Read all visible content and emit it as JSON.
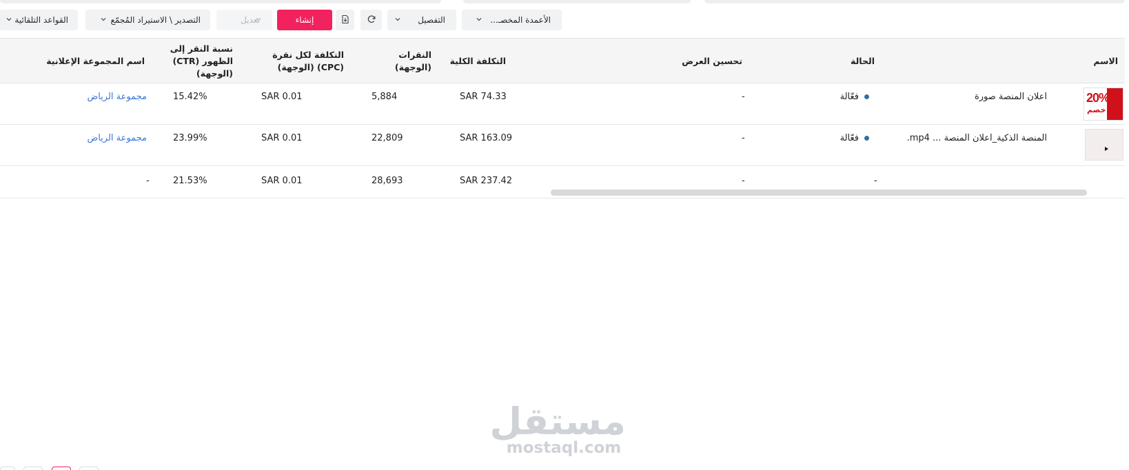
{
  "toolbar": {
    "auto_rules": "القواعد التلقائية",
    "export_import": "التصدير \\ الاستيراد المُجمّع",
    "edit": "تعديل",
    "create": "إنشاء",
    "breakdown": "التفصيل",
    "custom_columns": "الأعمدة المخصـ..."
  },
  "table": {
    "headers": {
      "name": "الاسم",
      "status": "الحالة",
      "optimization": "تحسين العرض",
      "total_cost": "التكلفة الكلية",
      "clicks": "النقرات (الوجهة)",
      "cpc": "التكلفة لكل نقرة (CPC) (الوجهة)",
      "ctr": "نسبة النقر إلى الظهور (CTR) (الوجهة)",
      "adgroup": "اسم المجموعة الإعلانية"
    },
    "rows": [
      {
        "name": "اعلان المنصة صورة",
        "status": "فعّالة",
        "optimization": "-",
        "total_cost": "SAR 74.33",
        "clicks": "5,884",
        "cpc": "SAR 0.01",
        "ctr": "15.42%",
        "adgroup": "مجموعة الرياض"
      },
      {
        "name": "المنصة الذكية_اعلان المنصة ... mp4.",
        "status": "فعّالة",
        "optimization": "-",
        "total_cost": "SAR 163.09",
        "clicks": "22,809",
        "cpc": "SAR 0.01",
        "ctr": "23.99%",
        "adgroup": "مجموعة الرياض"
      }
    ],
    "totals": {
      "status": "-",
      "optimization": "-",
      "total_cost": "SAR 237.42",
      "clicks": "28,693",
      "cpc": "SAR 0.01",
      "ctr": "21.53%",
      "adgroup": "-"
    }
  },
  "thumbnail": {
    "discount": "20%",
    "discount_word": "خصم"
  },
  "watermark": {
    "arabic": "مستقل",
    "latin": "mostaql.com"
  },
  "colors": {
    "accent": "#f2225f",
    "link": "#3b74d8",
    "status_dot": "#2f6fa3"
  }
}
